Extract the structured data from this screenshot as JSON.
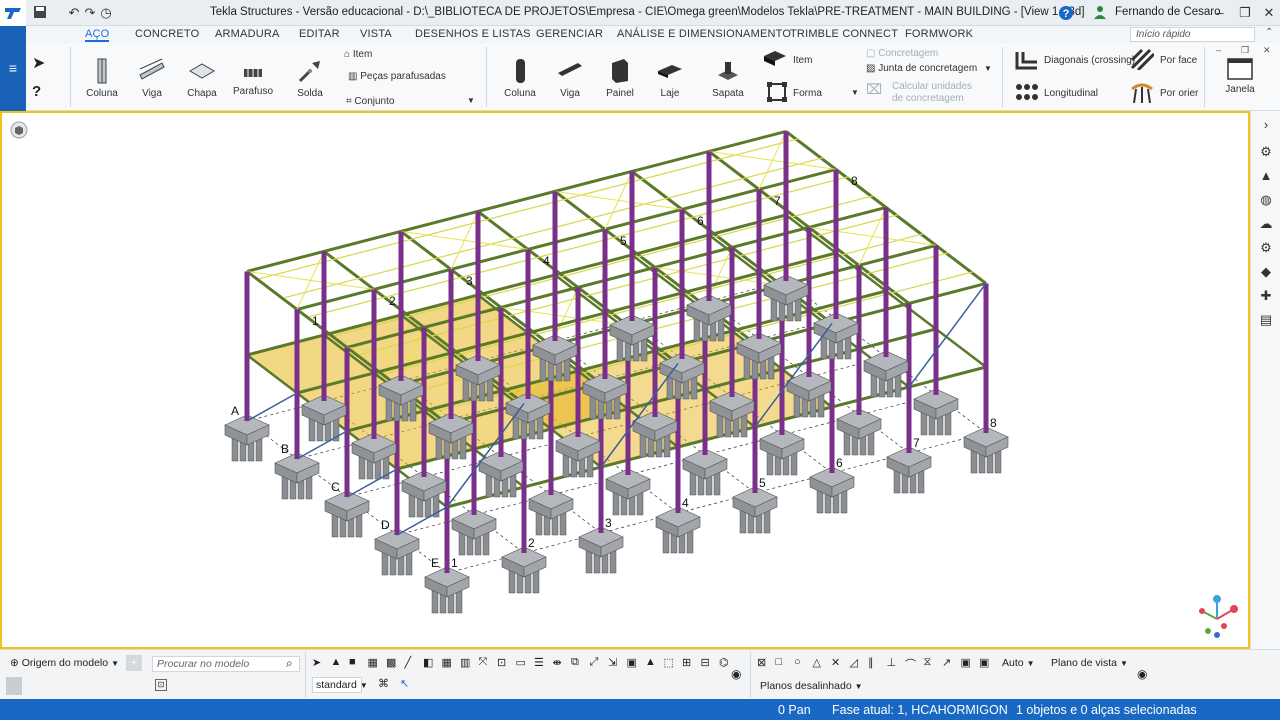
{
  "window": {
    "title": "Tekla Structures - Versão educacional - D:\\_BIBLIOTECA DE PROJETOS\\Empresa - CIE\\Omega green\\Modelos Tekla\\PRE-TREATMENT - MAIN BUILDING - [View 1 - 3d]",
    "user": "Fernando de Cesaro"
  },
  "menu": [
    "AÇO",
    "CONCRETO",
    "ARMADURA",
    "EDITAR",
    "VISTA",
    "DESENHOS E LISTAS",
    "GERENCIAR",
    "ANÁLISE E DIMENSIONAMENTO",
    "TRIMBLE CONNECT",
    "FORMWORK"
  ],
  "quick_search": {
    "placeholder": "Início rápido"
  },
  "ribbon": {
    "steel": {
      "coluna": "Coluna",
      "viga": "Viga",
      "chapa": "Chapa",
      "parafuso": "Parafuso",
      "solda": "Solda",
      "item": "Item",
      "pecas": "Peças parafusadas",
      "conjunto": "Conjunto"
    },
    "concrete": {
      "coluna": "Coluna",
      "viga": "Viga",
      "painel": "Painel",
      "laje": "Laje",
      "sapata": "Sapata",
      "item": "Item",
      "forma": "Forma",
      "concretagem": "Concretagem",
      "junta": "Junta de concretagem",
      "calcular": "Calcular unidades de concretagem"
    },
    "rebar": {
      "diagonais": "Diagonais (crossing)",
      "longitudinal": "Longitudinal",
      "por_face": "Por face",
      "por_orier": "Por orier"
    },
    "janela": "Janela"
  },
  "model": {
    "grid_letters": [
      "A",
      "B",
      "C",
      "D",
      "E"
    ],
    "grid_numbers": [
      "1",
      "2",
      "3",
      "4",
      "5",
      "6",
      "7",
      "8"
    ],
    "colors": {
      "steel": "#5a7a2a",
      "columns": "#7a2f8a",
      "slab": "#e8b620",
      "footing": "#8a8d91",
      "bracing": "#3a5f9a"
    }
  },
  "bottom": {
    "origem": "Origem do modelo",
    "search_placeholder": "Procurar no modelo",
    "standard": "standard",
    "auto": "Auto",
    "plano_vista": "Plano de vista",
    "planos": "Planos desalinhado"
  },
  "status": {
    "pan_label": "0  Pan",
    "fase": "Fase atual: 1, HCAHORMIGON",
    "selection": "1 objetos e 0 alças selecionadas"
  }
}
